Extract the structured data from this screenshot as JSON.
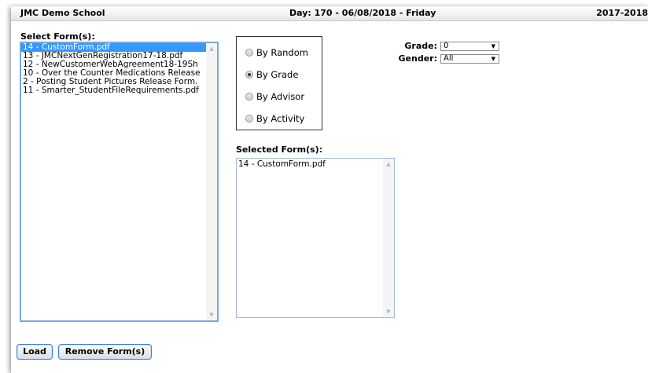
{
  "header": {
    "school": "JMC Demo School",
    "day": "Day: 170 - 06/08/2018 - Friday",
    "year": "2017-2018"
  },
  "select_forms": {
    "label": "Select Form(s):",
    "items": [
      "14 - CustomForm.pdf",
      "13 - JMCNextGenRegistration17-18.pdf",
      "12 - NewCustomerWebAgreement18-19Sh",
      "10 - Over the Counter Medications Release",
      "2 - Posting Student Pictures Release Form.",
      "11 - Smarter_StudentFileRequirements.pdf"
    ],
    "selected_index": 0
  },
  "options": {
    "items": [
      "By Random",
      "By Grade",
      "By Advisor",
      "By Activity"
    ],
    "checked_index": 1
  },
  "filters": {
    "grade_label": "Grade:",
    "grade_value": "0",
    "gender_label": "Gender:",
    "gender_value": "All"
  },
  "selected_forms": {
    "label": "Selected Form(s):",
    "items": [
      "14 - CustomForm.pdf"
    ]
  },
  "buttons": {
    "load": "Load",
    "remove": "Remove Form(s)"
  }
}
